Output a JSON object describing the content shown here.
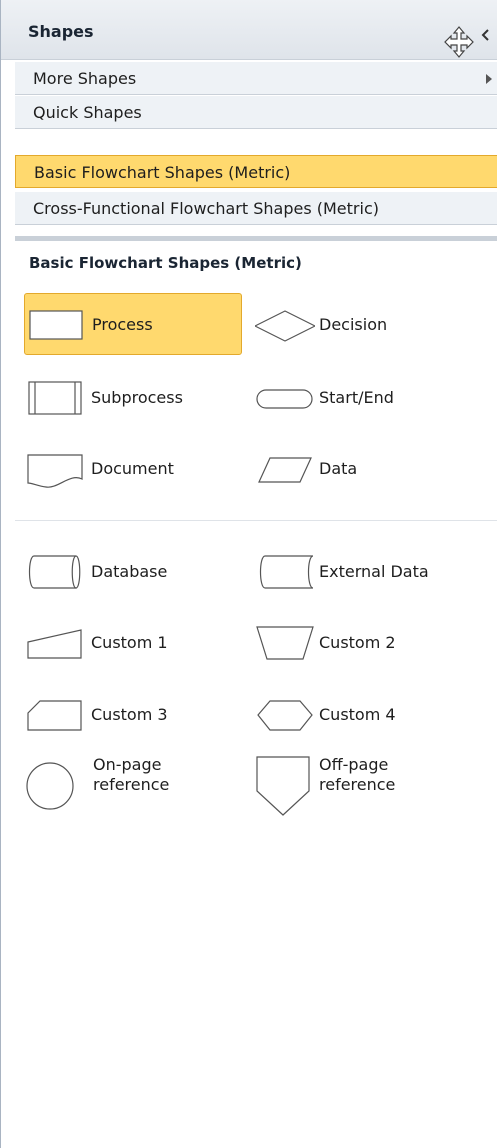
{
  "panel": {
    "title": "Shapes",
    "rows": {
      "more": "More Shapes",
      "quick": "Quick Shapes",
      "basic": "Basic Flowchart Shapes (Metric)",
      "cross": "Cross-Functional Flowchart Shapes (Metric)"
    },
    "stencil_title": "Basic Flowchart Shapes (Metric)",
    "shapes": {
      "process": "Process",
      "decision": "Decision",
      "subprocess": "Subprocess",
      "start_end": "Start/End",
      "document": "Document",
      "data": "Data",
      "database": "Database",
      "external_data": "External Data",
      "custom1": "Custom 1",
      "custom2": "Custom 2",
      "custom3": "Custom 3",
      "custom4": "Custom 4",
      "onpage_l1": "On-page",
      "onpage_l2": "reference",
      "offpage_l1": "Off-page",
      "offpage_l2": "reference"
    }
  },
  "colors": {
    "selected_fill": "#ffd96e",
    "selected_border": "#e3a92c",
    "shape_stroke": "#555555"
  }
}
